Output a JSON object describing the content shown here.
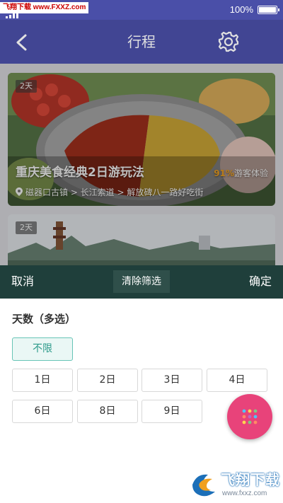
{
  "status_bar": {
    "watermark_text": "飞翔下载 www.FXXZ.com",
    "battery_text": "100%"
  },
  "header": {
    "title": "行程",
    "back_icon": "chevron-left-icon",
    "settings_icon": "gear-icon"
  },
  "trips": [
    {
      "days_badge": "2天",
      "title": "重庆美食经典2日游玩法",
      "rating_percent": "91%",
      "rating_label": "游客体验",
      "route": "磁器口古镇 > 长江索道 > 解放碑八一路好吃街"
    },
    {
      "days_badge": "2天"
    }
  ],
  "filter_bar": {
    "cancel_label": "取消",
    "clear_label": "清除筛选",
    "confirm_label": "确定"
  },
  "filter_panel": {
    "section_title": "天数（多选）",
    "options": [
      {
        "label": "不限",
        "selected": true
      },
      {
        "label": "1日",
        "selected": false
      },
      {
        "label": "2日",
        "selected": false
      },
      {
        "label": "3日",
        "selected": false
      },
      {
        "label": "4日",
        "selected": false
      },
      {
        "label": "6日",
        "selected": false
      },
      {
        "label": "8日",
        "selected": false
      },
      {
        "label": "9日",
        "selected": false
      }
    ]
  },
  "fab": {
    "icon": "dots-grid-icon",
    "color": "#e8437a"
  },
  "watermark": {
    "title": "飞翔下载",
    "url": "www.fxxz.com"
  },
  "colors": {
    "header_bg": "#4a4fa8",
    "filter_bar_bg": "#1f3f3b",
    "chip_selected_border": "#67c4b6",
    "chip_selected_text": "#2b9a8a"
  }
}
